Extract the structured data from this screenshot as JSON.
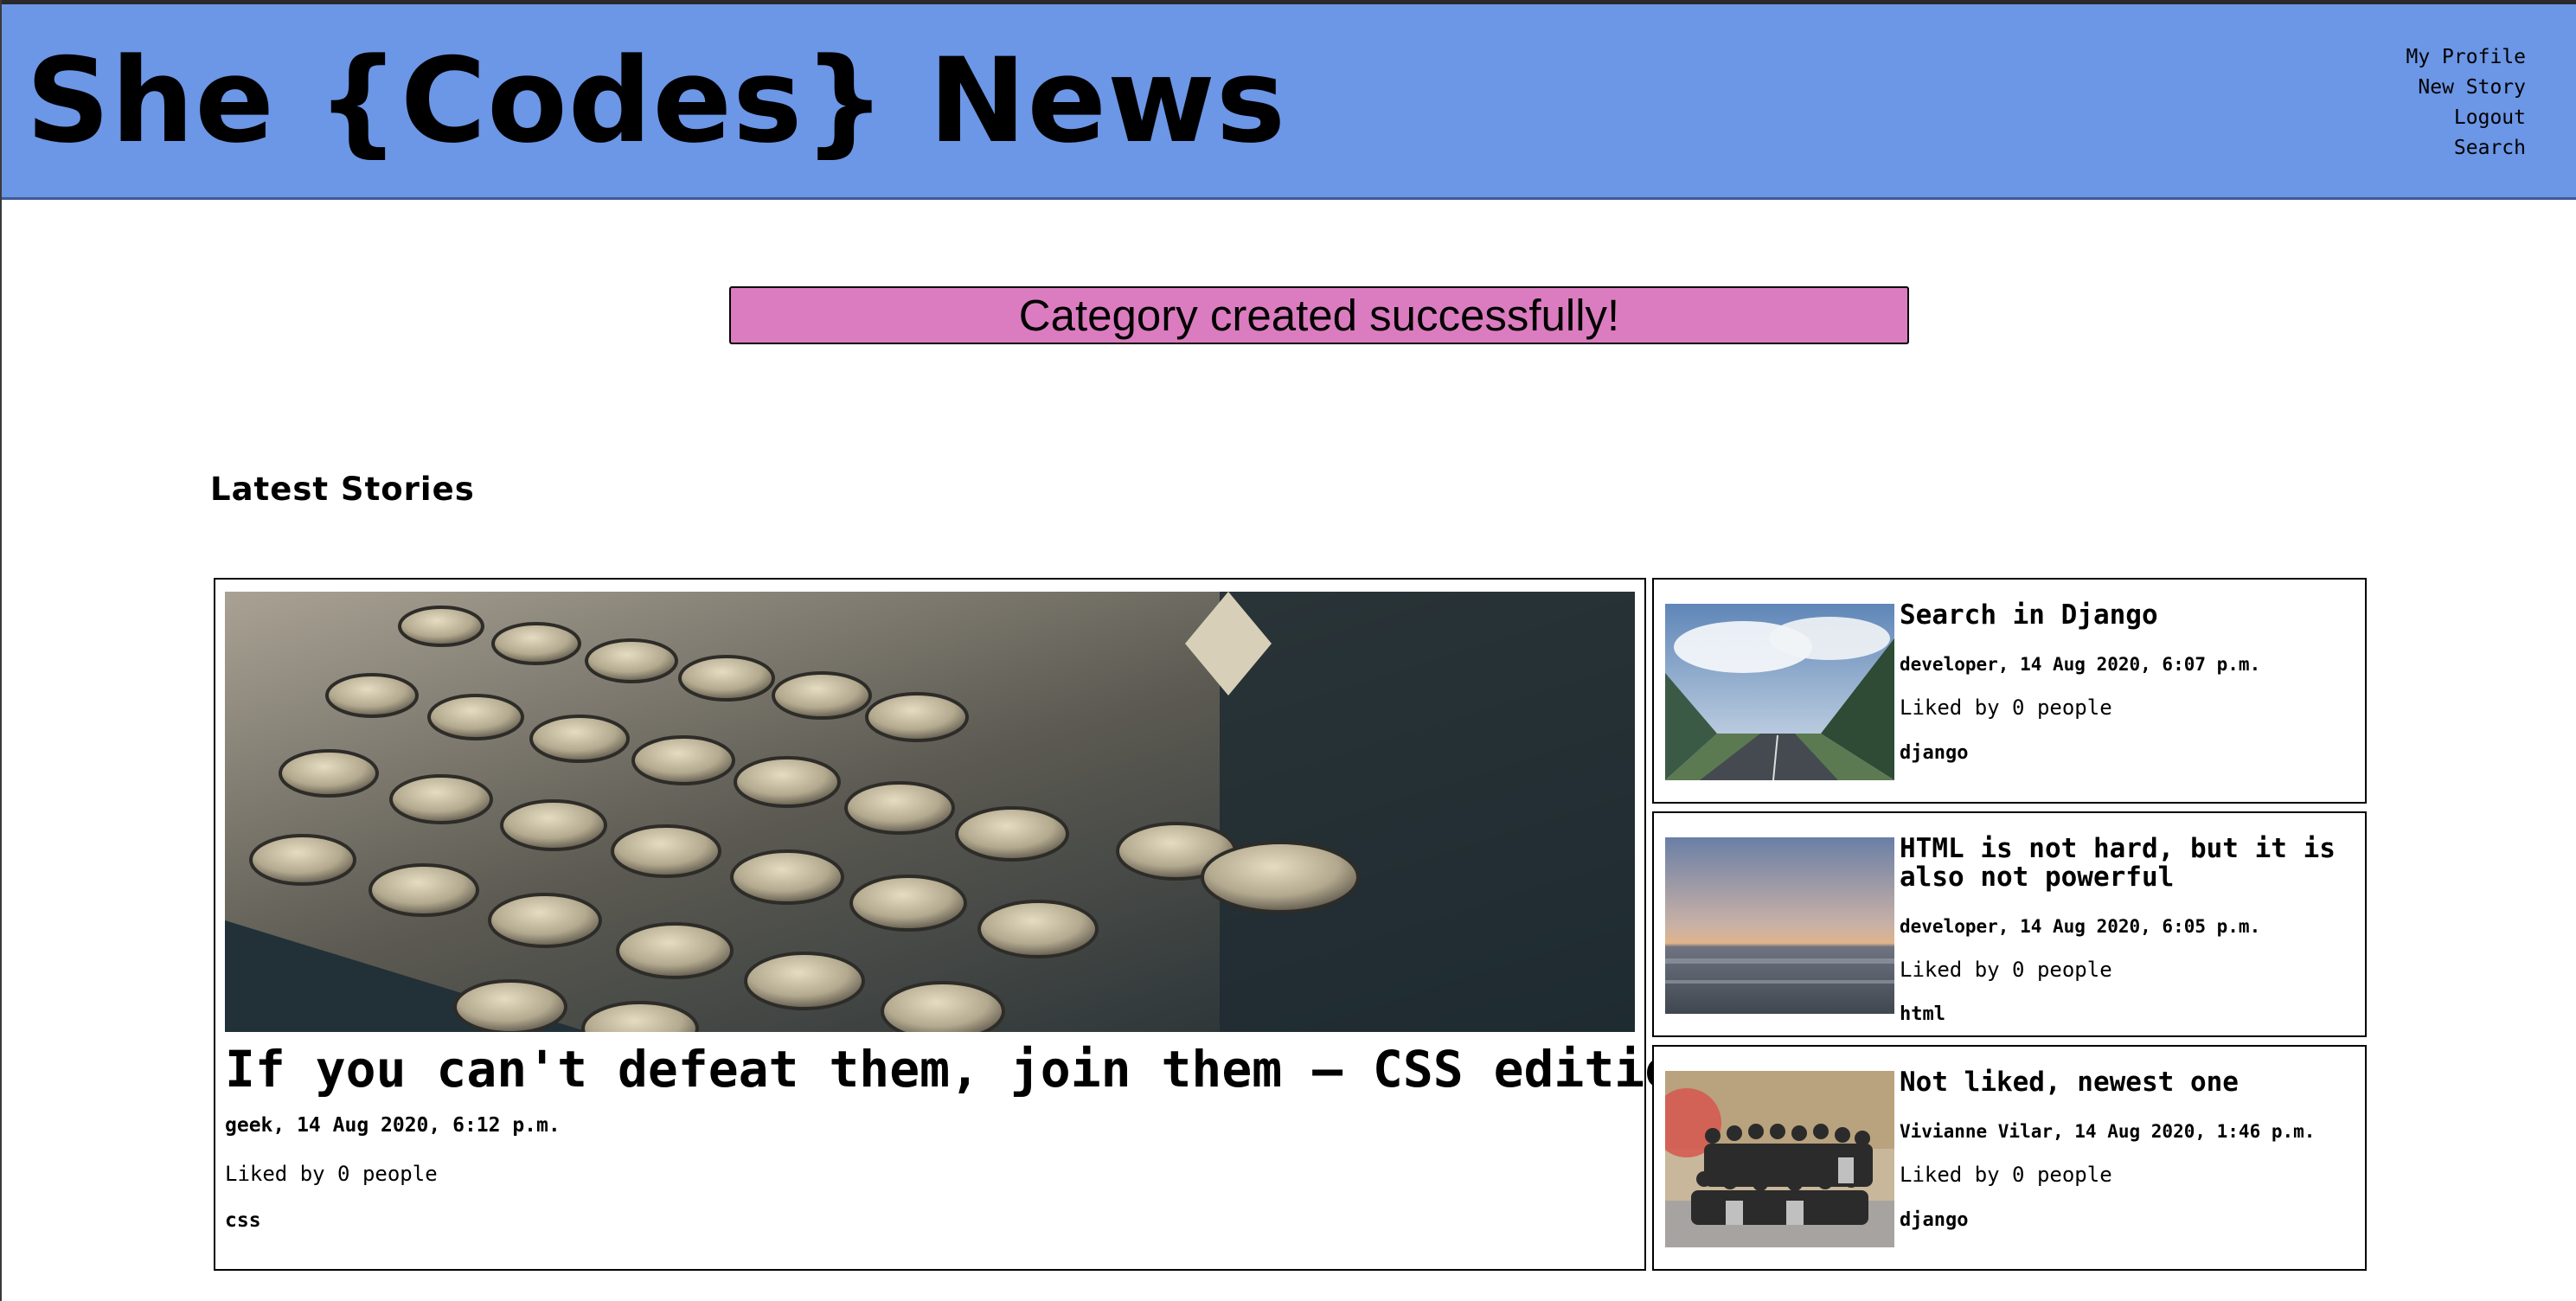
{
  "header": {
    "brand": "She {Codes} News",
    "nav": [
      "My Profile",
      "New Story",
      "Logout",
      "Search"
    ]
  },
  "alert": {
    "message": "Category created successfully!"
  },
  "main": {
    "section_title": "Latest Stories",
    "featured": {
      "title": "If you can't defeat them, join them – CSS edition",
      "meta": "geek, 14 Aug 2020, 6:12 p.m.",
      "likes": "Liked by 0 people",
      "category": "css",
      "image": "typewriter-photo"
    },
    "stories": [
      {
        "title": "Search in Django",
        "meta": "developer, 14 Aug 2020, 6:07 p.m.",
        "likes": "Liked by 0 people",
        "category": "django",
        "image": "mountain-road-photo"
      },
      {
        "title": "HTML is not hard, but it is also not powerful",
        "meta": "developer, 14 Aug 2020, 6:05 p.m.",
        "likes": "Liked by 0 people",
        "category": "html",
        "image": "sunset-sea-photo"
      },
      {
        "title": "Not liked, newest one",
        "meta": "Vivianne Vilar, 14 Aug 2020, 1:46 p.m.",
        "likes": "Liked by 0 people",
        "category": "django",
        "image": "group-photo"
      }
    ]
  },
  "colors": {
    "header_bg": "#6c96e6",
    "alert_bg": "#dc7cc0"
  }
}
